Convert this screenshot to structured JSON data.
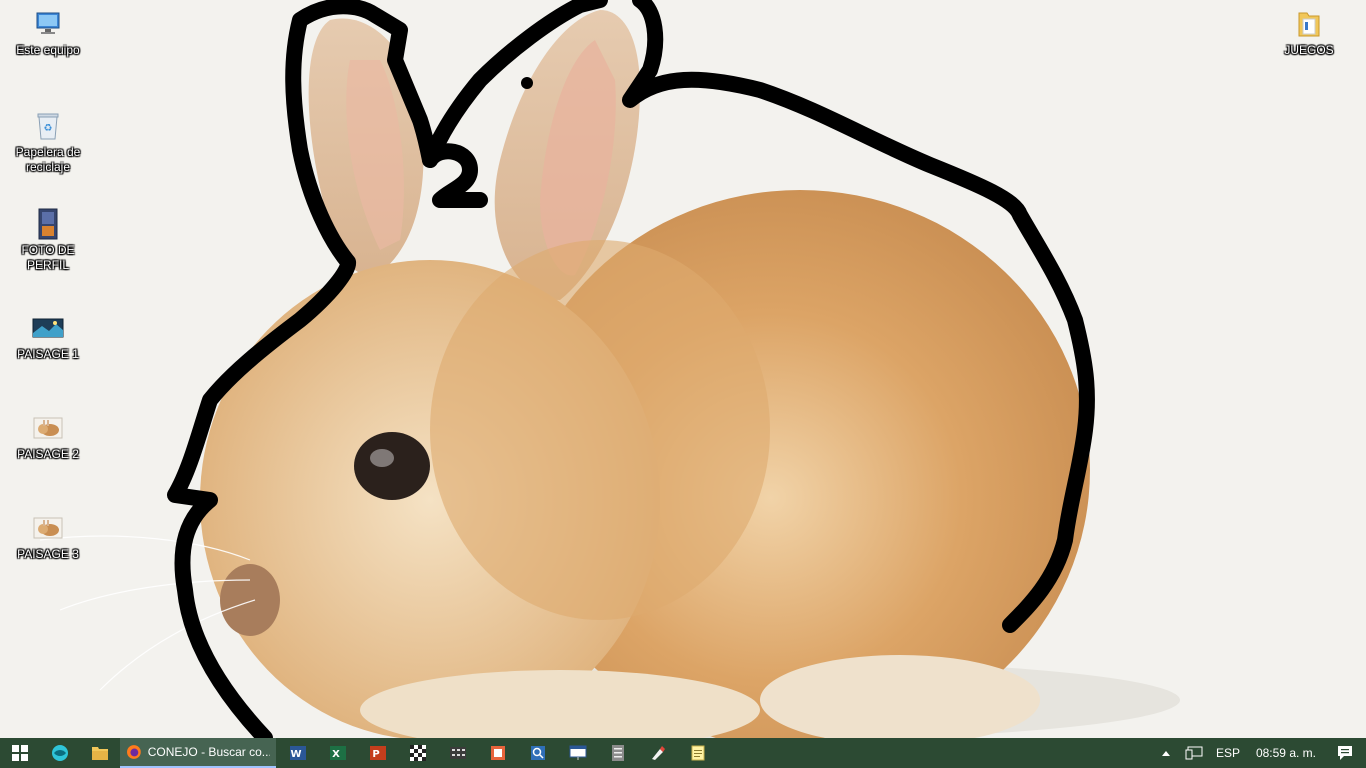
{
  "desktop": {
    "icons": [
      {
        "label": "Este equipo",
        "icon": "computer-icon"
      },
      {
        "label": "Papelera de reciclaje",
        "icon": "recycle-bin-icon"
      },
      {
        "label": "FOTO DE PERFIL",
        "icon": "image-file-icon"
      },
      {
        "label": "PAISAGE 1",
        "icon": "landscape-image-icon"
      },
      {
        "label": "PAISAGE 2",
        "icon": "rabbit-image-icon"
      },
      {
        "label": "PAISAGE 3",
        "icon": "rabbit-image-icon"
      },
      {
        "label": "JUEGOS",
        "icon": "folder-icon"
      }
    ],
    "wallpaper": {
      "subject": "rabbit-photo",
      "annotation_text": "2"
    }
  },
  "taskbar": {
    "active_window_title": "CONEJO - Buscar co...",
    "pinned": [
      "word-icon",
      "excel-icon",
      "powerpoint-icon",
      "chess-icon",
      "calculator-icon",
      "office-icon",
      "magnifier-icon",
      "presentation-icon",
      "files-icon",
      "paint-icon",
      "notes-icon"
    ],
    "tray": {
      "language": "ESP",
      "time": "08:59 a. m."
    }
  },
  "colors": {
    "taskbar": "#2c4a33",
    "active_app": "#466452",
    "fur": "#d9a46a"
  }
}
